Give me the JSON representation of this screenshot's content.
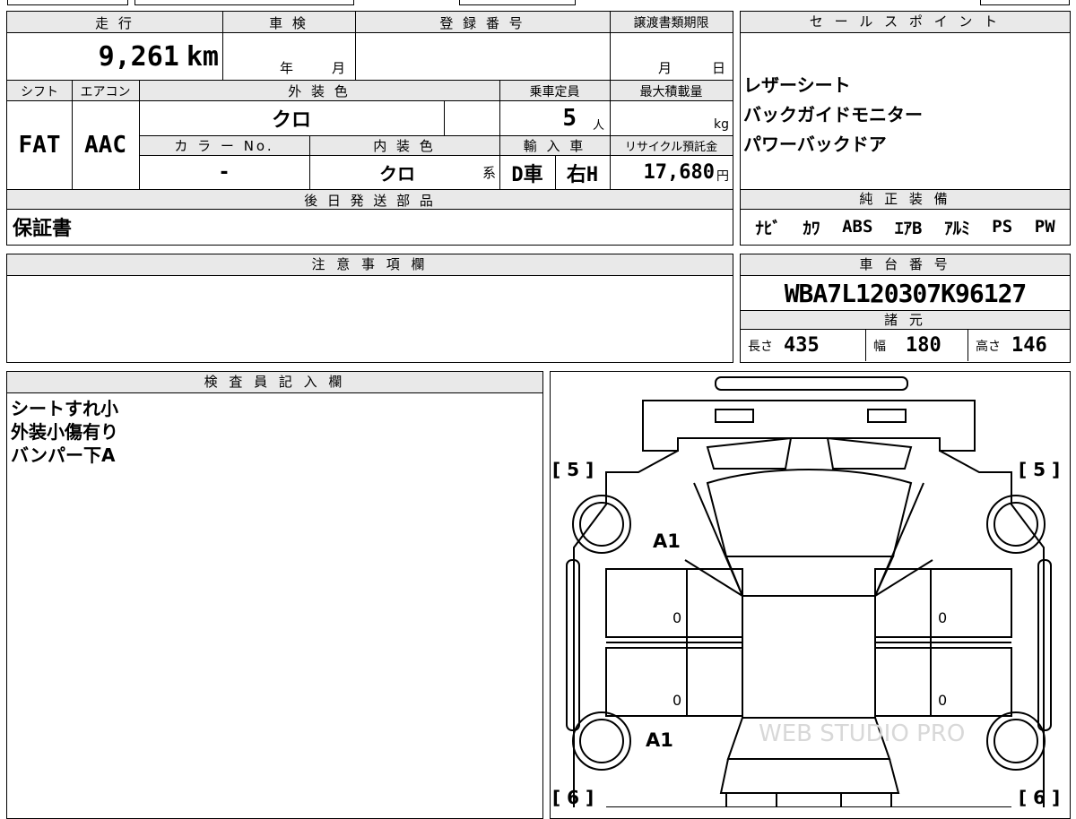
{
  "vehicle": {
    "mileage_label": "走 行",
    "mileage_value": "9,261",
    "mileage_unit": "km",
    "inspection_label": "車 検",
    "inspection_year_unit": "年",
    "inspection_month_unit": "月",
    "registration_label": "登 録 番 号",
    "transfer_deadline_label": "譲渡書類期限",
    "transfer_month_unit": "月",
    "transfer_day_unit": "日",
    "shift_label": "シフト",
    "shift_value": "FAT",
    "aircon_label": "エアコン",
    "aircon_value": "AAC",
    "exterior_color_label": "外 装 色",
    "exterior_color_value": "クロ",
    "color_no_label": "カ ラ ー No.",
    "color_no_value": "-",
    "interior_color_label": "内 装 色",
    "interior_color_value": "クロ",
    "interior_color_suffix": "系",
    "capacity_label": "乗車定員",
    "capacity_value": "5",
    "capacity_unit": "人",
    "max_load_label": "最大積載量",
    "max_load_unit": "kg",
    "import_label": "輸 入 車",
    "import_value": "D車",
    "steering_value": "右H",
    "recycle_label": "リサイクル預託金",
    "recycle_value": "17,680",
    "recycle_unit": "円",
    "later_parts_label": "後 日 発 送 部 品",
    "later_parts_value": "保証書"
  },
  "sales_points": {
    "label": "セ ー ル ス ポ イ ン ト",
    "items": [
      "レザーシート",
      "バックガイドモニター",
      "パワーバックドア"
    ]
  },
  "equipment": {
    "label": "純 正 装 備",
    "items": [
      "ﾅﾋﾞ",
      "ｶﾜ",
      "ABS",
      "ｴｱB",
      "ｱﾙﾐ",
      "PS",
      "PW"
    ]
  },
  "notes": {
    "label": "注 意 事 項 欄",
    "value": ""
  },
  "chassis": {
    "label": "車 台 番 号",
    "value": "WBA7L120307K96127",
    "specs_label": "諸 元",
    "length_label": "長さ",
    "length_value": "435",
    "width_label": "幅",
    "width_value": "180",
    "height_label": "高さ",
    "height_value": "146"
  },
  "inspector": {
    "label": "検 査 員 記 入 欄",
    "lines": [
      "シートすれ小",
      "外装小傷有り",
      "バンパー下A"
    ]
  },
  "diagram": {
    "tread_front_left": "[ 5 ]",
    "tread_front_right": "[ 5 ]",
    "tread_rear_left": "[ 6 ]",
    "tread_rear_right": "[ 6 ]",
    "mark_front": "A1",
    "mark_rear": "A1",
    "zero_lf": "0",
    "zero_rf": "0",
    "zero_lr": "0",
    "zero_rr": "0",
    "watermark": "WEB STUDIO PRO"
  }
}
